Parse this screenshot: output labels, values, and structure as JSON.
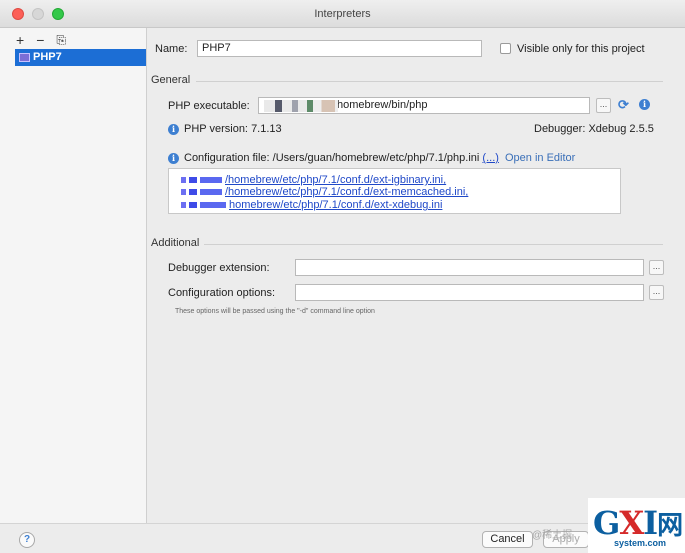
{
  "window": {
    "title": "Interpreters"
  },
  "sidebar": {
    "tools": {
      "add": "+",
      "remove": "−",
      "copy": "⎘"
    },
    "items": [
      {
        "label": "PHP7"
      }
    ]
  },
  "form": {
    "name_label": "Name:",
    "name_value": "PHP7",
    "visible_only_label": "Visible only for this project",
    "visible_only_checked": false
  },
  "general": {
    "section_label": "General",
    "php_executable_label": "PHP executable:",
    "php_executable_value": "homebrew/bin/php",
    "browse_label": "...",
    "php_version_label": "PHP version:",
    "php_version_value": "7.1.13",
    "debugger_label": "Debugger:",
    "debugger_value": "Xdebug 2.5.5",
    "config_file_label": "Configuration file:",
    "config_file_value": "/Users/guan/homebrew/etc/php/7.1/php.ini",
    "config_more_link": "(...)",
    "open_in_editor_link": "Open in Editor",
    "additional_ini_files": [
      "/homebrew/etc/php/7.1/conf.d/ext-igbinary.ini,",
      "/homebrew/etc/php/7.1/conf.d/ext-memcached.ini,",
      "homebrew/etc/php/7.1/conf.d/ext-xdebug.ini"
    ]
  },
  "additional": {
    "section_label": "Additional",
    "debugger_extension_label": "Debugger extension:",
    "debugger_extension_value": "",
    "configuration_options_label": "Configuration options:",
    "configuration_options_value": "",
    "browse_label": "...",
    "hint": "These options will be passed using the \"-d\" command line option"
  },
  "footer": {
    "help_label": "?",
    "cancel_label": "Cancel",
    "apply_label": "Apply"
  },
  "watermark": {
    "logo_g": "G",
    "logo_x": "X",
    "logo_i": "I",
    "logo_cn": "网",
    "domain": "system.com",
    "faint_text": "@稀土掘"
  },
  "colors": {
    "accent": "#1c6ed5",
    "link": "#1f48c8",
    "info": "#3d7fd1"
  }
}
